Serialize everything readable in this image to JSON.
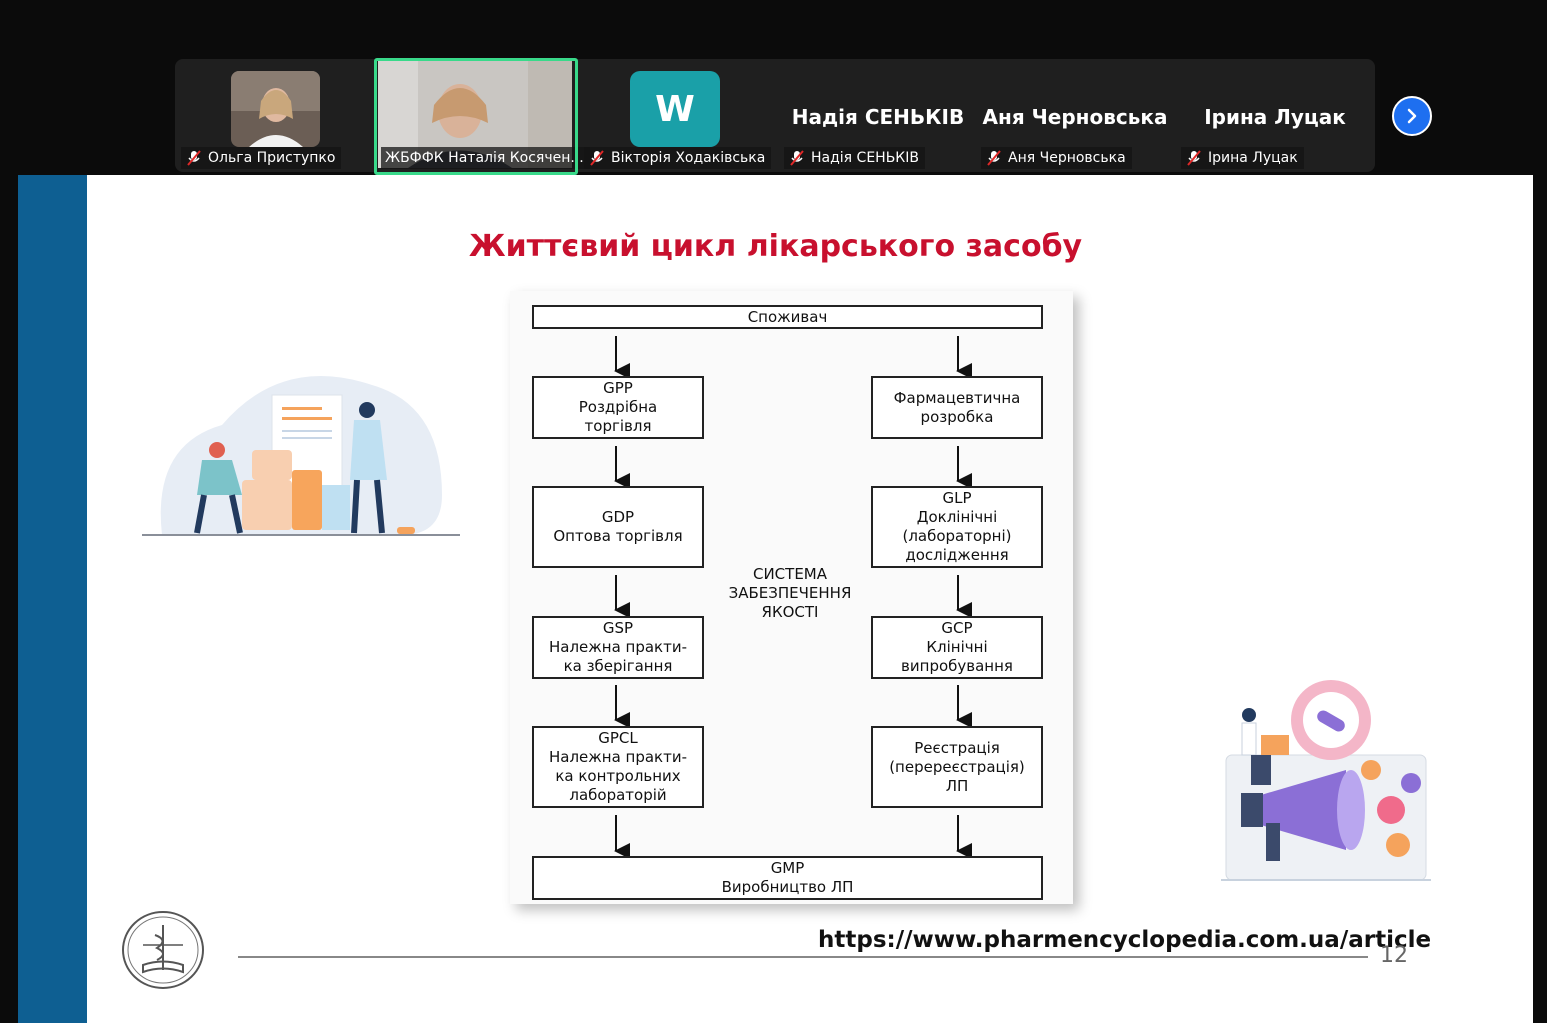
{
  "participants": [
    {
      "name": "Ольга Приступко",
      "avatar": "photo"
    },
    {
      "name": "ЖБФФК Наталія Косячен...",
      "avatar": "video"
    },
    {
      "name": "Вікторія Ходаківська",
      "avatar_letter": "W"
    },
    {
      "name": "Надія СЕНЬКІВ",
      "big_name": "Надія СЕНЬКІВ"
    },
    {
      "name": "Аня Черновська",
      "big_name": "Аня Черновська"
    },
    {
      "name": "Ірина Луцак",
      "big_name": "Ірина Луцак"
    }
  ],
  "icons": {
    "muted": "mic-muted-icon",
    "next": "chevron-right-icon"
  },
  "colors": {
    "accent": "#1e6ff0",
    "active_speaker": "#39d98a",
    "title": "#c8102e",
    "slide_bar": "#0e5f92"
  },
  "slide": {
    "title": "Життєвий цикл лікарського засобу",
    "top_box": "Споживач",
    "left": [
      {
        "code": "GPP",
        "text": [
          "Роздрібна",
          "торгівля"
        ]
      },
      {
        "code": "GDP",
        "text": [
          "Оптова торгівля"
        ]
      },
      {
        "code": "GSP",
        "text": [
          "Належна практи-",
          "ка зберігання"
        ]
      },
      {
        "code": "GPCL",
        "text": [
          "Належна практи-",
          "ка контрольних",
          "лабораторій"
        ]
      }
    ],
    "right": [
      {
        "code": "",
        "text": [
          "Фармацевтична",
          "розробка"
        ]
      },
      {
        "code": "GLP",
        "text": [
          "Доклінічні",
          "(лабораторні)",
          "дослідження"
        ]
      },
      {
        "code": "GCP",
        "text": [
          "Клінічні",
          "випробування"
        ]
      },
      {
        "code": "",
        "text": [
          "Реєстрація",
          "(перереєстрація)",
          "ЛП"
        ]
      }
    ],
    "center": [
      "СИСТЕМА",
      "ЗАБЕЗПЕЧЕННЯ",
      "ЯКОСТІ"
    ],
    "bottom": {
      "code": "GMP",
      "text": "Виробництво ЛП"
    },
    "url": "https://www.pharmencyclopedia.com.ua/article",
    "page_number": "12"
  }
}
